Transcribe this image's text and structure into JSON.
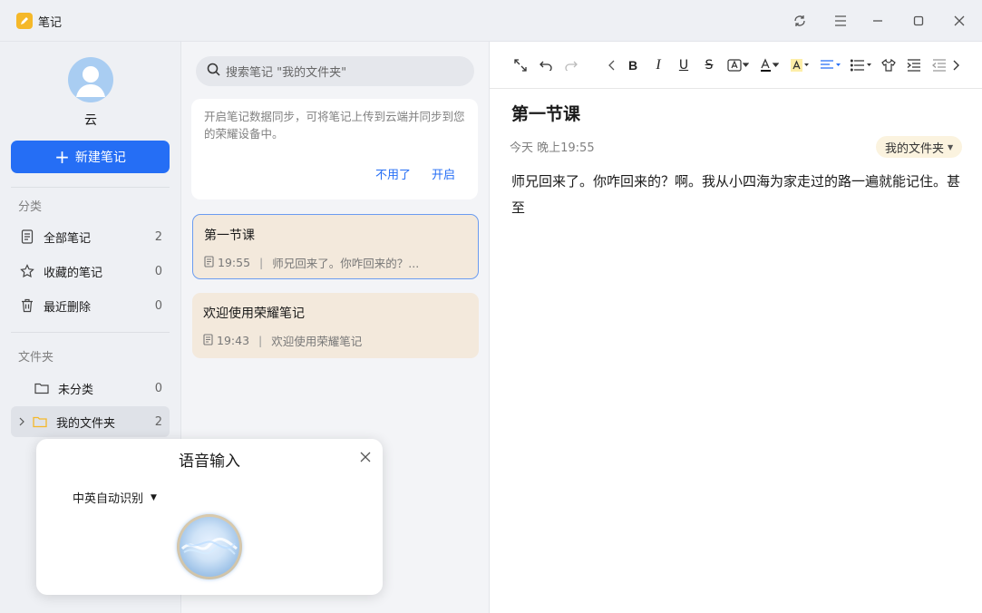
{
  "app": {
    "title": "笔记"
  },
  "sidebar": {
    "user_name": "云",
    "new_note_label": "新建笔记",
    "categories_label": "分类",
    "categories": [
      {
        "label": "全部笔记",
        "count": "2",
        "icon": "document-icon"
      },
      {
        "label": "收藏的笔记",
        "count": "0",
        "icon": "star-icon"
      },
      {
        "label": "最近删除",
        "count": "0",
        "icon": "trash-icon"
      }
    ],
    "folders_label": "文件夹",
    "folders": [
      {
        "label": "未分类",
        "count": "0",
        "icon": "folder-icon"
      },
      {
        "label": "我的文件夹",
        "count": "2",
        "icon": "folder-icon",
        "active": true
      }
    ]
  },
  "notelist": {
    "search_placeholder": "搜索笔记 \"我的文件夹\"",
    "sync_text": "开启笔记数据同步，可将笔记上传到云端并同步到您的荣耀设备中。",
    "sync_decline": "不用了",
    "sync_enable": "开启",
    "notes": [
      {
        "title": "第一节课",
        "time": "19:55",
        "preview": "师兄回来了。你咋回来的？...",
        "selected": true
      },
      {
        "title": "欢迎使用荣耀笔记",
        "time": "19:43",
        "preview": "欢迎使用荣耀笔记",
        "selected": false
      }
    ]
  },
  "editor": {
    "title": "第一节课",
    "timestamp": "今天 晚上19:55",
    "folder": "我的文件夹",
    "body": "师兄回来了。你咋回来的？啊。我从小四海为家走过的路一遍就能记住。甚至"
  },
  "voice_input": {
    "title": "语音输入",
    "language": "中英自动识别"
  },
  "colors": {
    "accent": "#256ef5",
    "note_card": "#f3e9dc",
    "folder_icon": "#f5b829"
  }
}
